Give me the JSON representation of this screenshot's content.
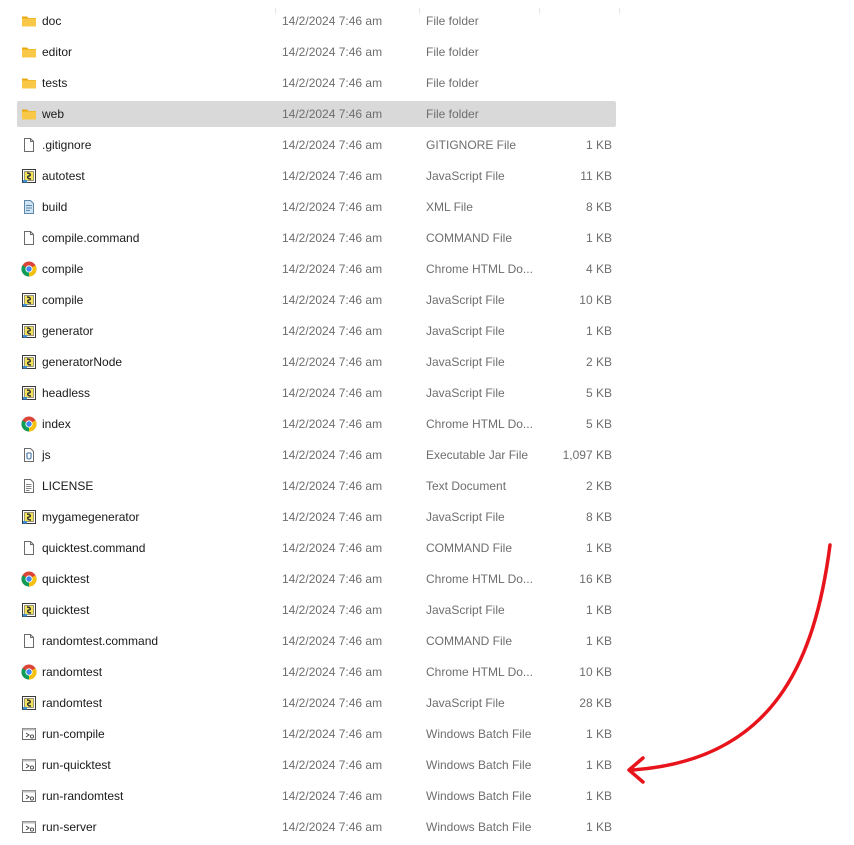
{
  "files": [
    {
      "name": "doc",
      "date": "14/2/2024 7:46 am",
      "type": "File folder",
      "size": "",
      "icon": "folder-icon",
      "selected": false
    },
    {
      "name": "editor",
      "date": "14/2/2024 7:46 am",
      "type": "File folder",
      "size": "",
      "icon": "folder-icon",
      "selected": false
    },
    {
      "name": "tests",
      "date": "14/2/2024 7:46 am",
      "type": "File folder",
      "size": "",
      "icon": "folder-icon",
      "selected": false
    },
    {
      "name": "web",
      "date": "14/2/2024 7:46 am",
      "type": "File folder",
      "size": "",
      "icon": "folder-icon",
      "selected": true
    },
    {
      "name": ".gitignore",
      "date": "14/2/2024 7:46 am",
      "type": "GITIGNORE File",
      "size": "1 KB",
      "icon": "file-icon",
      "selected": false
    },
    {
      "name": "autotest",
      "date": "14/2/2024 7:46 am",
      "type": "JavaScript File",
      "size": "11 KB",
      "icon": "javascript-file-icon",
      "selected": false
    },
    {
      "name": "build",
      "date": "14/2/2024 7:46 am",
      "type": "XML File",
      "size": "8 KB",
      "icon": "xml-file-icon",
      "selected": false
    },
    {
      "name": "compile.command",
      "date": "14/2/2024 7:46 am",
      "type": "COMMAND File",
      "size": "1 KB",
      "icon": "file-icon",
      "selected": false
    },
    {
      "name": "compile",
      "date": "14/2/2024 7:46 am",
      "type": "Chrome HTML Do...",
      "size": "4 KB",
      "icon": "chrome-icon",
      "selected": false
    },
    {
      "name": "compile",
      "date": "14/2/2024 7:46 am",
      "type": "JavaScript File",
      "size": "10 KB",
      "icon": "javascript-file-icon",
      "selected": false
    },
    {
      "name": "generator",
      "date": "14/2/2024 7:46 am",
      "type": "JavaScript File",
      "size": "1 KB",
      "icon": "javascript-file-icon",
      "selected": false
    },
    {
      "name": "generatorNode",
      "date": "14/2/2024 7:46 am",
      "type": "JavaScript File",
      "size": "2 KB",
      "icon": "javascript-file-icon",
      "selected": false
    },
    {
      "name": "headless",
      "date": "14/2/2024 7:46 am",
      "type": "JavaScript File",
      "size": "5 KB",
      "icon": "javascript-file-icon",
      "selected": false
    },
    {
      "name": "index",
      "date": "14/2/2024 7:46 am",
      "type": "Chrome HTML Do...",
      "size": "5 KB",
      "icon": "chrome-icon",
      "selected": false
    },
    {
      "name": "js",
      "date": "14/2/2024 7:46 am",
      "type": "Executable Jar File",
      "size": "1,097 KB",
      "icon": "jar-file-icon",
      "selected": false
    },
    {
      "name": "LICENSE",
      "date": "14/2/2024 7:46 am",
      "type": "Text Document",
      "size": "2 KB",
      "icon": "text-document-icon",
      "selected": false
    },
    {
      "name": "mygamegenerator",
      "date": "14/2/2024 7:46 am",
      "type": "JavaScript File",
      "size": "8 KB",
      "icon": "javascript-file-icon",
      "selected": false
    },
    {
      "name": "quicktest.command",
      "date": "14/2/2024 7:46 am",
      "type": "COMMAND File",
      "size": "1 KB",
      "icon": "file-icon",
      "selected": false
    },
    {
      "name": "quicktest",
      "date": "14/2/2024 7:46 am",
      "type": "Chrome HTML Do...",
      "size": "16 KB",
      "icon": "chrome-icon",
      "selected": false
    },
    {
      "name": "quicktest",
      "date": "14/2/2024 7:46 am",
      "type": "JavaScript File",
      "size": "1 KB",
      "icon": "javascript-file-icon",
      "selected": false
    },
    {
      "name": "randomtest.command",
      "date": "14/2/2024 7:46 am",
      "type": "COMMAND File",
      "size": "1 KB",
      "icon": "file-icon",
      "selected": false
    },
    {
      "name": "randomtest",
      "date": "14/2/2024 7:46 am",
      "type": "Chrome HTML Do...",
      "size": "10 KB",
      "icon": "chrome-icon",
      "selected": false
    },
    {
      "name": "randomtest",
      "date": "14/2/2024 7:46 am",
      "type": "JavaScript File",
      "size": "28 KB",
      "icon": "javascript-file-icon",
      "selected": false
    },
    {
      "name": "run-compile",
      "date": "14/2/2024 7:46 am",
      "type": "Windows Batch File",
      "size": "1 KB",
      "icon": "batch-file-icon",
      "selected": false
    },
    {
      "name": "run-quicktest",
      "date": "14/2/2024 7:46 am",
      "type": "Windows Batch File",
      "size": "1 KB",
      "icon": "batch-file-icon",
      "selected": false
    },
    {
      "name": "run-randomtest",
      "date": "14/2/2024 7:46 am",
      "type": "Windows Batch File",
      "size": "1 KB",
      "icon": "batch-file-icon",
      "selected": false
    },
    {
      "name": "run-server",
      "date": "14/2/2024 7:46 am",
      "type": "Windows Batch File",
      "size": "1 KB",
      "icon": "batch-file-icon",
      "selected": false
    }
  ],
  "colors": {
    "selected_row": "#d9d9d9",
    "folder": "#f8c846",
    "annotation_arrow": "#e8141b"
  },
  "annotation": {
    "icon": "red-arrow-icon",
    "target": "run-quicktest"
  }
}
